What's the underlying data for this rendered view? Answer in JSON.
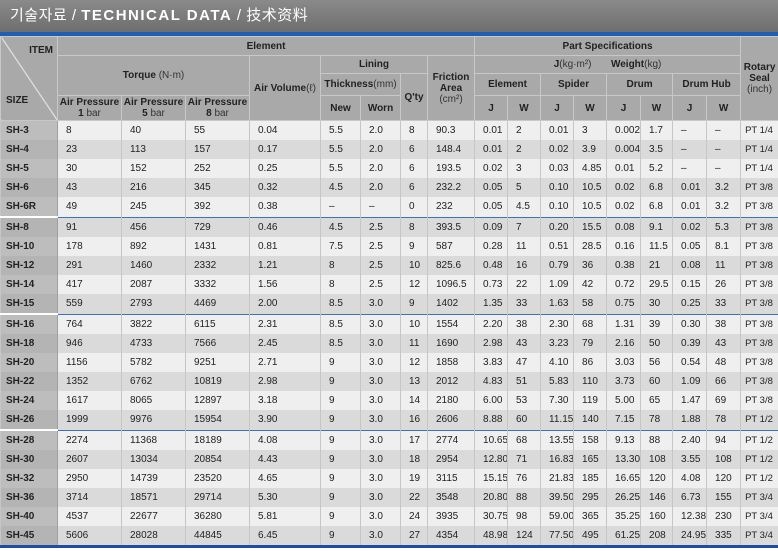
{
  "title": {
    "korean": "기술자료",
    "sep1": " / ",
    "english": "TECHNICAL DATA",
    "sep2": " / ",
    "chinese": "技术资料"
  },
  "header": {
    "item": "ITEM",
    "size": "SIZE",
    "element": "Element",
    "torque": "Torque",
    "torque_unit": "(N·m)",
    "air_pressure": "Air Pressure",
    "p1": "1",
    "p5": "5",
    "p8": "8",
    "bar": "bar",
    "air_volume": "Air Volume",
    "air_volume_unit": "(ℓ)",
    "lining": "Lining",
    "thickness": "Thickness",
    "thickness_unit": "(mm)",
    "new": "New",
    "worn": "Worn",
    "qty": "Q'ty",
    "friction_area": "Friction Area",
    "friction_unit": "(cm²)",
    "part_specs": "Part Specifications",
    "j_label": "J",
    "j_unit": "(kg·m²)",
    "weight_label": "Weight",
    "weight_unit": "(kg)",
    "p_element": "Element",
    "p_spider": "Spider",
    "p_drum": "Drum",
    "p_drumhub": "Drum Hub",
    "J": "J",
    "W": "W",
    "rotary_seal": "Rotary Seal",
    "seal_unit": "(inch)"
  },
  "rows": [
    [
      "SH-3",
      "8",
      "40",
      "55",
      "0.04",
      "5.5",
      "2.0",
      "8",
      "90.3",
      "0.01",
      "2",
      "0.01",
      "3",
      "0.002",
      "1.7",
      "–",
      "–",
      "PT 1/4"
    ],
    [
      "SH-4",
      "23",
      "113",
      "157",
      "0.17",
      "5.5",
      "2.0",
      "6",
      "148.4",
      "0.01",
      "2",
      "0.02",
      "3.9",
      "0.004",
      "3.5",
      "–",
      "–",
      "PT 1/4"
    ],
    [
      "SH-5",
      "30",
      "152",
      "252",
      "0.25",
      "5.5",
      "2.0",
      "6",
      "193.5",
      "0.02",
      "3",
      "0.03",
      "4.85",
      "0.01",
      "5.2",
      "–",
      "–",
      "PT 1/4"
    ],
    [
      "SH-6",
      "43",
      "216",
      "345",
      "0.32",
      "4.5",
      "2.0",
      "6",
      "232.2",
      "0.05",
      "5",
      "0.10",
      "10.5",
      "0.02",
      "6.8",
      "0.01",
      "3.2",
      "PT 3/8"
    ],
    [
      "SH-6R",
      "49",
      "245",
      "392",
      "0.38",
      "–",
      "–",
      "0",
      "232",
      "0.05",
      "4.5",
      "0.10",
      "10.5",
      "0.02",
      "6.8",
      "0.01",
      "3.2",
      "PT 3/8"
    ],
    [
      "SH-8",
      "91",
      "456",
      "729",
      "0.46",
      "4.5",
      "2.5",
      "8",
      "393.5",
      "0.09",
      "7",
      "0.20",
      "15.5",
      "0.08",
      "9.1",
      "0.02",
      "5.3",
      "PT 3/8"
    ],
    [
      "SH-10",
      "178",
      "892",
      "1431",
      "0.81",
      "7.5",
      "2.5",
      "9",
      "587",
      "0.28",
      "11",
      "0.51",
      "28.5",
      "0.16",
      "11.5",
      "0.05",
      "8.1",
      "PT 3/8"
    ],
    [
      "SH-12",
      "291",
      "1460",
      "2332",
      "1.21",
      "8",
      "2.5",
      "10",
      "825.6",
      "0.48",
      "16",
      "0.79",
      "36",
      "0.38",
      "21",
      "0.08",
      "11",
      "PT 3/8"
    ],
    [
      "SH-14",
      "417",
      "2087",
      "3332",
      "1.56",
      "8",
      "2.5",
      "12",
      "1096.5",
      "0.73",
      "22",
      "1.09",
      "42",
      "0.72",
      "29.5",
      "0.15",
      "26",
      "PT 3/8"
    ],
    [
      "SH-15",
      "559",
      "2793",
      "4469",
      "2.00",
      "8.5",
      "3.0",
      "9",
      "1402",
      "1.35",
      "33",
      "1.63",
      "58",
      "0.75",
      "30",
      "0.25",
      "33",
      "PT 3/8"
    ],
    [
      "SH-16",
      "764",
      "3822",
      "6115",
      "2.31",
      "8.5",
      "3.0",
      "10",
      "1554",
      "2.20",
      "38",
      "2.30",
      "68",
      "1.31",
      "39",
      "0.30",
      "38",
      "PT 3/8"
    ],
    [
      "SH-18",
      "946",
      "4733",
      "7566",
      "2.45",
      "8.5",
      "3.0",
      "11",
      "1690",
      "2.98",
      "43",
      "3.23",
      "79",
      "2.16",
      "50",
      "0.39",
      "43",
      "PT 3/8"
    ],
    [
      "SH-20",
      "1156",
      "5782",
      "9251",
      "2.71",
      "9",
      "3.0",
      "12",
      "1858",
      "3.83",
      "47",
      "4.10",
      "86",
      "3.03",
      "56",
      "0.54",
      "48",
      "PT 3/8"
    ],
    [
      "SH-22",
      "1352",
      "6762",
      "10819",
      "2.98",
      "9",
      "3.0",
      "13",
      "2012",
      "4.83",
      "51",
      "5.83",
      "110",
      "3.73",
      "60",
      "1.09",
      "66",
      "PT 3/8"
    ],
    [
      "SH-24",
      "1617",
      "8065",
      "12897",
      "3.18",
      "9",
      "3.0",
      "14",
      "2180",
      "6.00",
      "53",
      "7.30",
      "119",
      "5.00",
      "65",
      "1.47",
      "69",
      "PT 3/8"
    ],
    [
      "SH-26",
      "1999",
      "9976",
      "15954",
      "3.90",
      "9",
      "3.0",
      "16",
      "2606",
      "8.88",
      "60",
      "11.15",
      "140",
      "7.15",
      "78",
      "1.88",
      "78",
      "PT 1/2"
    ],
    [
      "SH-28",
      "2274",
      "11368",
      "18189",
      "4.08",
      "9",
      "3.0",
      "17",
      "2774",
      "10.65",
      "68",
      "13.55",
      "158",
      "9.13",
      "88",
      "2.40",
      "94",
      "PT 1/2"
    ],
    [
      "SH-30",
      "2607",
      "13034",
      "20854",
      "4.43",
      "9",
      "3.0",
      "18",
      "2954",
      "12.80",
      "71",
      "16.83",
      "165",
      "13.30",
      "108",
      "3.55",
      "108",
      "PT 1/2"
    ],
    [
      "SH-32",
      "2950",
      "14739",
      "23520",
      "4.65",
      "9",
      "3.0",
      "19",
      "3115",
      "15.15",
      "76",
      "21.83",
      "185",
      "16.65",
      "120",
      "4.08",
      "120",
      "PT 1/2"
    ],
    [
      "SH-36",
      "3714",
      "18571",
      "29714",
      "5.30",
      "9",
      "3.0",
      "22",
      "3548",
      "20.80",
      "88",
      "39.50",
      "295",
      "26.25",
      "146",
      "6.73",
      "155",
      "PT 3/4"
    ],
    [
      "SH-40",
      "4537",
      "22677",
      "36280",
      "5.81",
      "9",
      "3.0",
      "24",
      "3935",
      "30.75",
      "98",
      "59.00",
      "365",
      "35.25",
      "160",
      "12.38",
      "230",
      "PT 3/4"
    ],
    [
      "SH-45",
      "5606",
      "28028",
      "44845",
      "6.45",
      "9",
      "3.0",
      "27",
      "4354",
      "48.98",
      "124",
      "77.50",
      "495",
      "61.25",
      "208",
      "24.95",
      "335",
      "PT 3/4"
    ]
  ],
  "group_starts": [
    "SH-8",
    "SH-16",
    "SH-28"
  ],
  "colors": {
    "accent_blue": "#1f5fb3",
    "header_gray": "#a9a9a9",
    "row_light": "#efefef",
    "row_dark": "#dadada"
  }
}
